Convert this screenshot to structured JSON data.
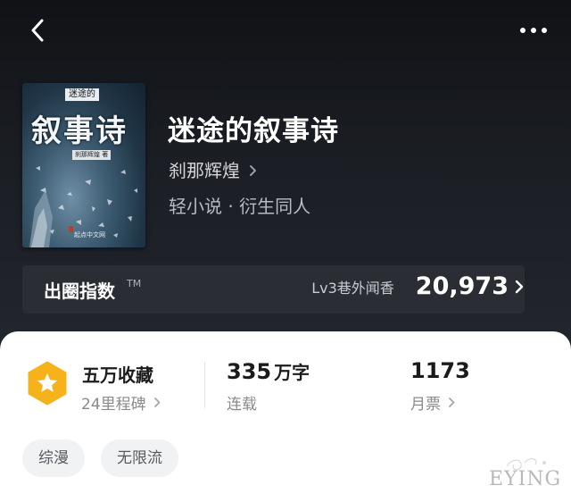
{
  "header": {
    "back_icon": "chevron-left-icon",
    "more_icon": "more-horizontal-icon"
  },
  "book": {
    "title": "迷途的叙事诗",
    "author": "刹那辉煌",
    "genre": "轻小说 · 衍生同人",
    "cover": {
      "top_text": "迷途的",
      "title_text": "叙事诗",
      "author_text": "刹那辉煌 著",
      "site_text": "起点中文网"
    }
  },
  "index": {
    "label": "出圈指数",
    "tm": "TM",
    "level": "Lv3巷外闻香",
    "value": "20,973"
  },
  "stats": {
    "favorites_main": "五万收藏",
    "favorites_sub": "24里程碑",
    "words_number": "335",
    "words_unit": "万字",
    "status": "连载",
    "tickets_main": "1173",
    "tickets_sub": "月票"
  },
  "tags": [
    "综漫",
    "无限流"
  ],
  "watermark": {
    "text": "EYING"
  },
  "colors": {
    "hero_bg": "#1b1e24",
    "badge": "#f6b21b",
    "panel_bg": "#ffffff"
  }
}
